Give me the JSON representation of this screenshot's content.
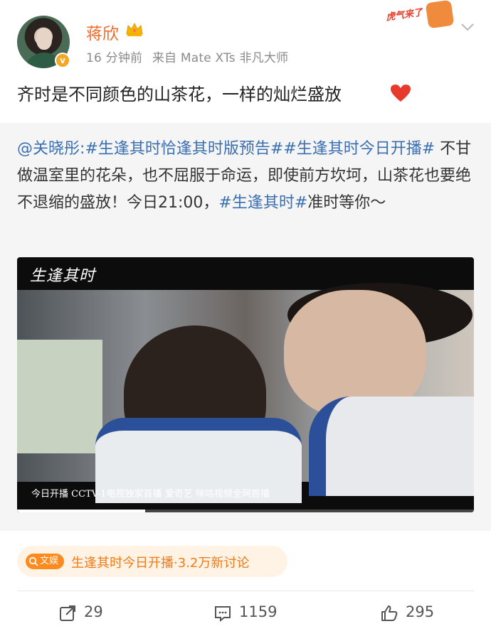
{
  "post": {
    "author": "蒋欣",
    "time": "16 分钟前",
    "source": "来自 Mate XTs 非凡大师",
    "sticker_text": "虎气来了",
    "text": "齐时是不同颜色的山茶花，一样的灿烂盛放",
    "icons": [
      "crown-icon",
      "chevron-down-icon",
      "heart-icon",
      "verified-icon"
    ]
  },
  "repost": {
    "mention": "@关晓彤",
    "colon": ":",
    "tag1": "#生逢其时恰逢其时版预告#",
    "tag2": "#生逢其时今日开播#",
    "body": " 不甘做温室里的花朵，也不屈服于命运，即使前方坎坷，山茶花也要绝不退缩的盛放！今日21:00，",
    "tag3": "#生逢其时#",
    "ending": "准时等你～"
  },
  "video": {
    "logo": "生逢其时",
    "caption": "今日开播 CCTV-1电视独家首播 爱奇艺 咪咕视频全网首播",
    "progress": 0.28
  },
  "topic": {
    "badge": "文娱",
    "text": "生逢其时今日开播·3.2万新讨论"
  },
  "actions": {
    "repost_count": "29",
    "comment_count": "1159",
    "like_count": "295"
  },
  "colors": {
    "username": "#f06b2b",
    "link": "#3a6fb2",
    "topic_bg": "#fff3e6",
    "topic_text": "#f07b18",
    "repost_bg": "#f5f5f5"
  }
}
